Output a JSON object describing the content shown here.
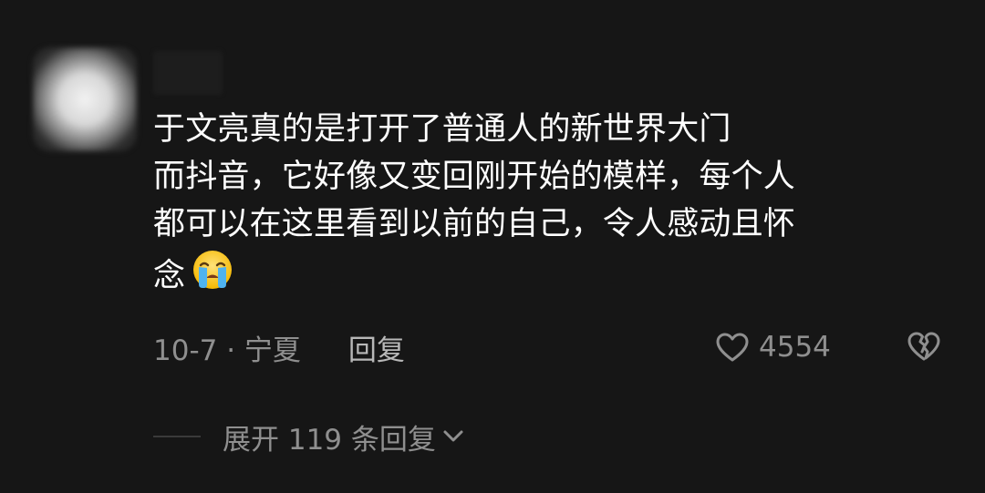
{
  "comment": {
    "lines": [
      "于文亮真的是打开了普通人的新世界大门",
      "而抖音，它好像又变回刚开始的模样，每个人",
      "都可以在这里看到以前的自己，令人感动且怀",
      "念"
    ],
    "emoji": "loudly-crying-face"
  },
  "meta": {
    "date_location": "10-7 · 宁夏",
    "reply_label": "回复"
  },
  "actions": {
    "like_count": "4554",
    "like_icon": "heart-icon",
    "dislike_icon": "broken-heart-icon"
  },
  "replies": {
    "expand_label": "展开 119 条回复"
  },
  "colors": {
    "background": "#161616",
    "primary_text": "#ffffff",
    "secondary_text": "#8f8f8f"
  }
}
